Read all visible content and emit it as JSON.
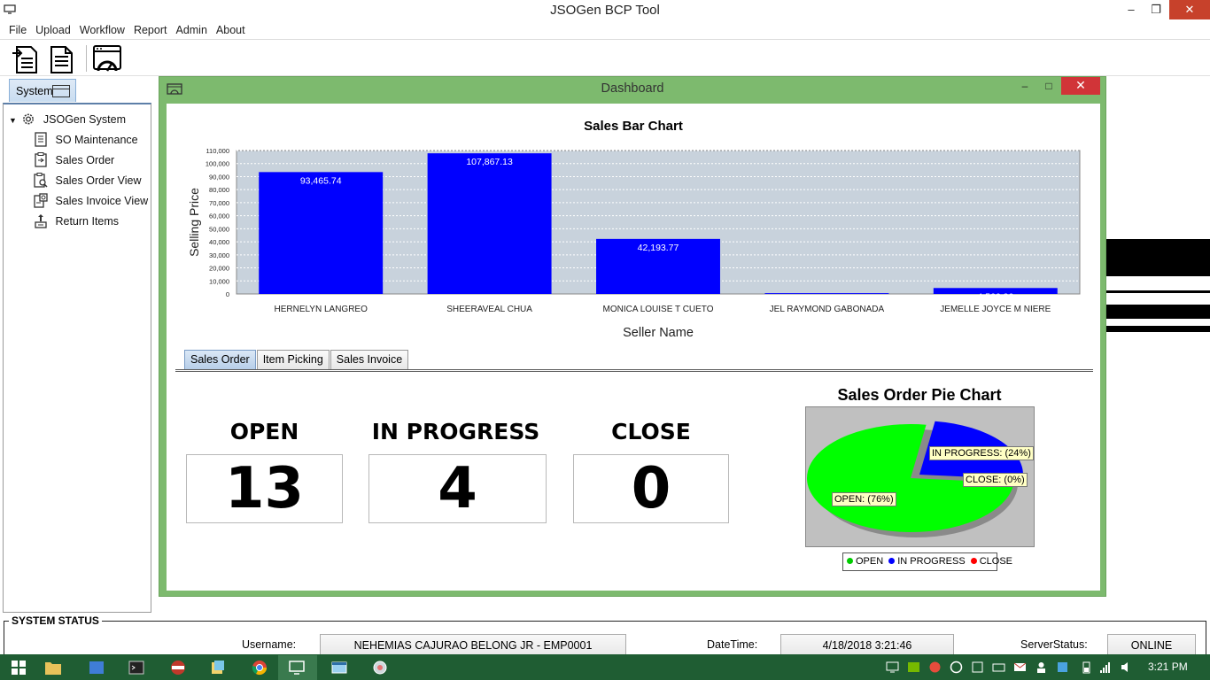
{
  "window": {
    "title": "JSOGen BCP Tool",
    "minimize": "–",
    "maximize": "❐",
    "close": "✕"
  },
  "menu": [
    "File",
    "Upload",
    "Workflow",
    "Report",
    "Admin",
    "About"
  ],
  "sidebar": {
    "tab_label": "System",
    "root": "JSOGen System",
    "items": [
      {
        "label": "SO Maintenance",
        "icon": "document-list-icon"
      },
      {
        "label": "Sales Order",
        "icon": "clipboard-icon"
      },
      {
        "label": "Sales Order View",
        "icon": "clipboard-search-icon"
      },
      {
        "label": "Sales Invoice View",
        "icon": "invoice-view-icon"
      },
      {
        "label": "Return Items",
        "icon": "return-items-icon"
      }
    ]
  },
  "dashboard": {
    "title": "Dashboard",
    "minimize": "–",
    "maximize": "□",
    "close": "✕",
    "tabs": [
      "Sales Order",
      "Item Picking",
      "Sales Invoice"
    ],
    "active_tab": 0,
    "counters": [
      {
        "label": "OPEN",
        "value": "13"
      },
      {
        "label": "IN PROGRESS",
        "value": "4"
      },
      {
        "label": "CLOSE",
        "value": "0"
      }
    ]
  },
  "chart_data": [
    {
      "type": "bar",
      "title": "Sales Bar Chart",
      "xlabel": "Seller Name",
      "ylabel": "Selling Price",
      "categories": [
        "HERNELYN LANGREO",
        "SHEERAVEAL CHUA",
        "MONICA LOUISE T CUETO",
        "JEL RAYMOND GABONADA",
        "JEMELLE JOYCE M NIERE"
      ],
      "values": [
        93465.74,
        107867.13,
        42193.77,
        600,
        4566.26
      ],
      "data_labels": [
        "93,465.74",
        "107,867.13",
        "42,193.77",
        "",
        "4,566.26"
      ],
      "ylim": [
        0,
        110000
      ],
      "yticks": [
        "0",
        "10,000",
        "20,000",
        "30,000",
        "40,000",
        "50,000",
        "60,000",
        "70,000",
        "80,000",
        "90,000",
        "100,000",
        "110,000"
      ],
      "grid": true,
      "bar_color": "#0000ff",
      "plot_bg": "#c8d2dc"
    },
    {
      "type": "pie",
      "title": "Sales Order Pie Chart",
      "slices": [
        {
          "name": "OPEN",
          "value": 76,
          "label": "OPEN: (76%)",
          "color": "#00ff00"
        },
        {
          "name": "IN PROGRESS",
          "value": 24,
          "label": "IN PROGRESS: (24%)",
          "color": "#0000ff"
        },
        {
          "name": "CLOSE",
          "value": 0,
          "label": "CLOSE: (0%)",
          "color": "#ff0000"
        }
      ],
      "legend": "bottom"
    }
  ],
  "status": {
    "heading": "SYSTEM STATUS",
    "username_label": "Username:",
    "username": "NEHEMIAS CAJURAO BELONG JR - EMP0001",
    "datetime_label": "DateTime:",
    "datetime": "4/18/2018  3:21:46",
    "server_label": "ServerStatus:",
    "server": "ONLINE"
  },
  "taskbar": {
    "clock": "3:21 PM"
  }
}
